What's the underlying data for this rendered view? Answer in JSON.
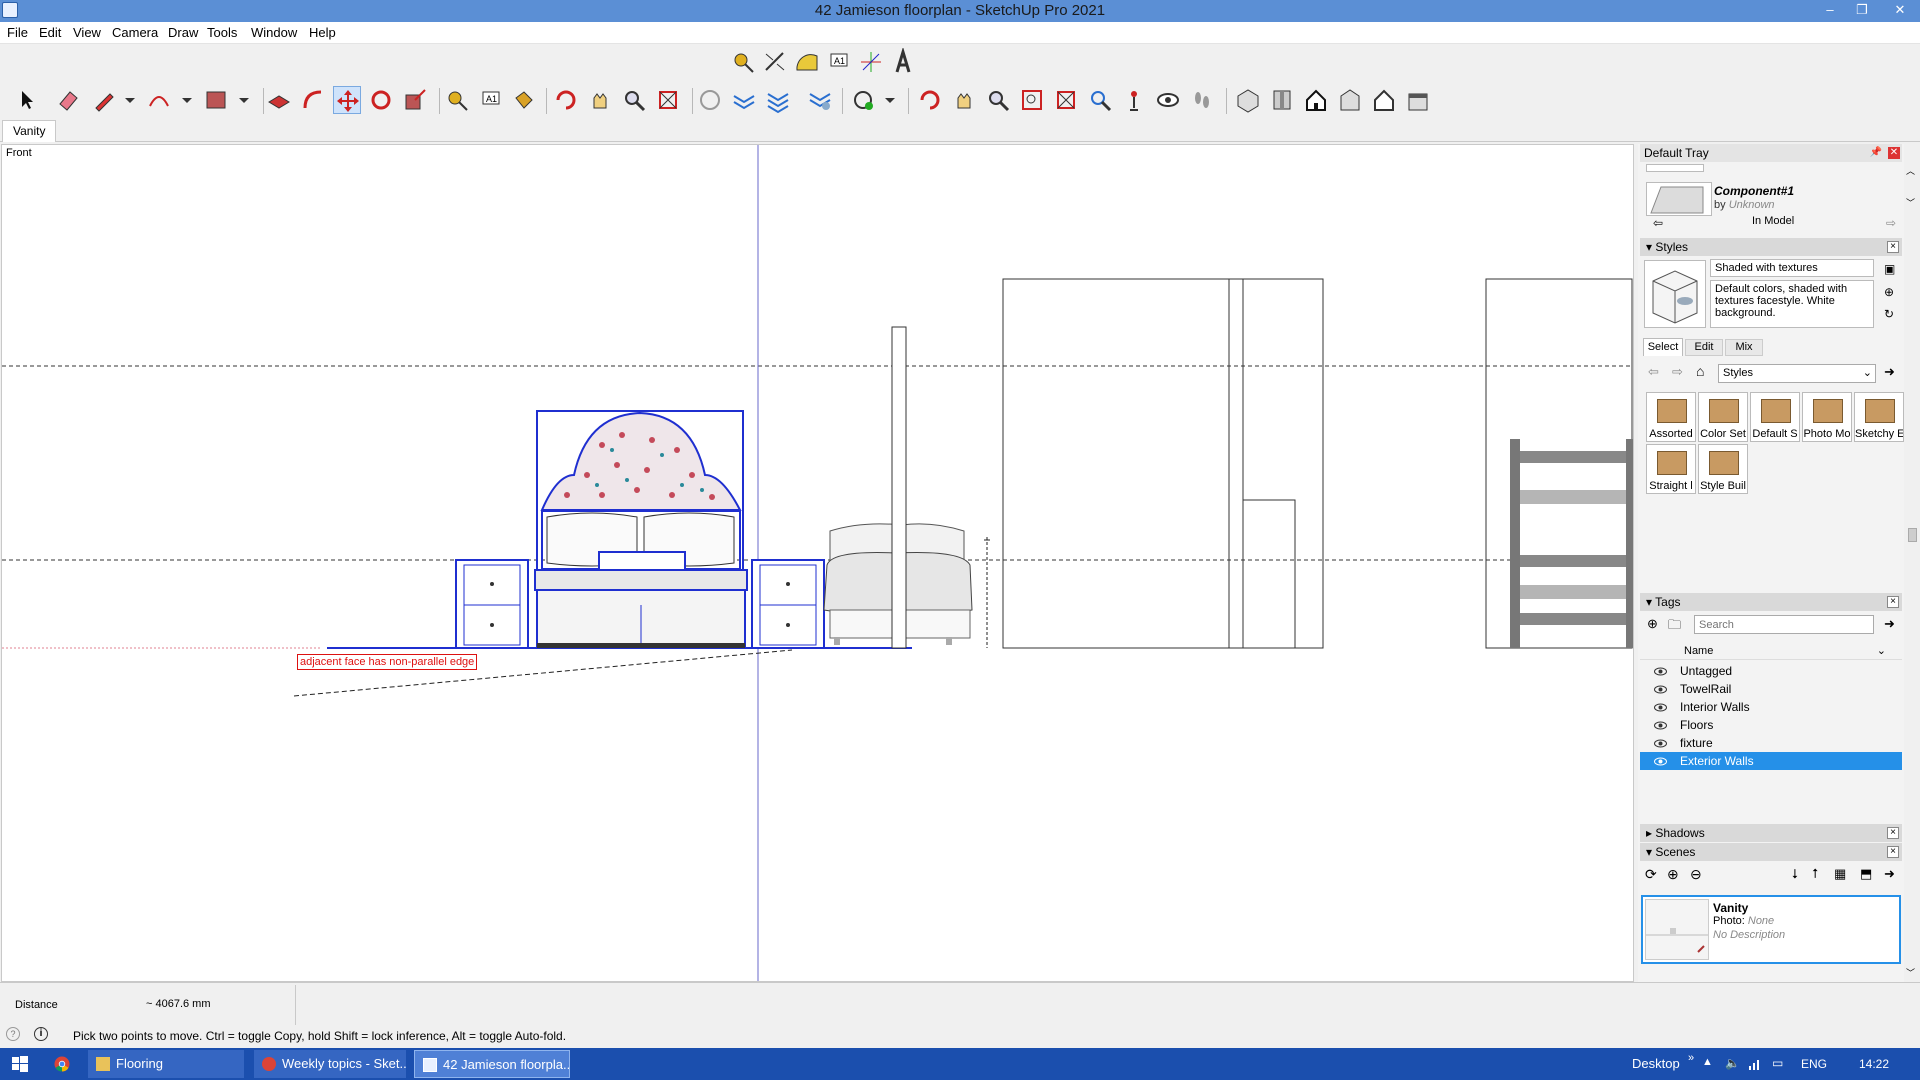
{
  "window": {
    "title": "42 Jamieson floorplan - SketchUp Pro 2021",
    "minimize": "–",
    "restore": "❐",
    "close": "✕"
  },
  "menu": [
    "File",
    "Edit",
    "View",
    "Camera",
    "Draw",
    "Tools",
    "Window",
    "Help"
  ],
  "scene_tabs": [
    "Vanity"
  ],
  "viewport": {
    "view_name": "Front",
    "tooltip": "adjacent face has non-parallel edge"
  },
  "tray": {
    "title": "Default Tray",
    "component": {
      "name": "Component#1",
      "by_label": "by",
      "author": "Unknown",
      "in_model": "In Model"
    },
    "styles": {
      "header": "Styles",
      "name": "Shaded with textures",
      "description": "Default colors, shaded with textures facestyle. White background.",
      "tabs": [
        "Select",
        "Edit",
        "Mix"
      ],
      "library": "Styles",
      "thumbs": [
        "Assorted",
        "Color Set",
        "Default S",
        "Photo Mo",
        "Sketchy E",
        "Straight l",
        "Style Buil"
      ]
    },
    "tags": {
      "header": "Tags",
      "search_placeholder": "Search",
      "col_name": "Name",
      "items": [
        "Untagged",
        "TowelRail",
        "Interior Walls",
        "Floors",
        "fixture",
        "Exterior Walls"
      ],
      "selected": "Exterior Walls"
    },
    "shadows": "Shadows",
    "scenes": {
      "header": "Scenes",
      "name": "Vanity",
      "photo_label": "Photo:",
      "photo_value": "None",
      "description": "No Description"
    }
  },
  "status": {
    "measure_label": "Distance",
    "measure_value": "~ 4067.6 mm",
    "hint": "Pick two points to move.  Ctrl = toggle Copy, hold Shift = lock inference, Alt = toggle Auto-fold."
  },
  "taskbar": {
    "tasks": [
      "Flooring",
      "Weekly topics - Sket...",
      "42 Jamieson floorpla..."
    ],
    "desktop": "Desktop",
    "lang": "ENG",
    "clock": "14:22"
  },
  "colors": {
    "title_bar": "#5b8fd5",
    "selection_blue": "#1f2fd0",
    "tag_selected": "#2590e8",
    "taskbar": "#1b4fae"
  }
}
